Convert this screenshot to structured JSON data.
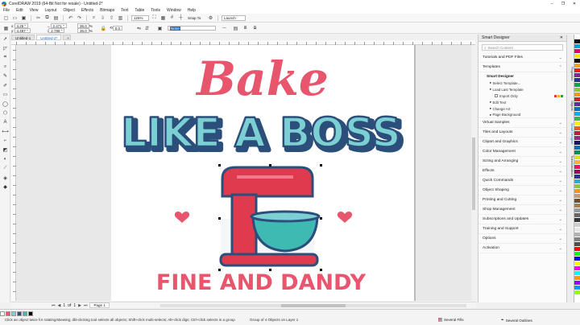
{
  "window": {
    "title": "CorelDRAW 2019 (64-Bit Not for resale) - Untitled-2*",
    "controls": [
      "–",
      "❐",
      "✕"
    ]
  },
  "menu": [
    "File",
    "Edit",
    "View",
    "Layout",
    "Object",
    "Effects",
    "Bitmaps",
    "Text",
    "Table",
    "Tools",
    "Window",
    "Help"
  ],
  "toolbar": {
    "zoom": "125%",
    "snap_to": "Snap To",
    "launch": "Launch"
  },
  "propbar": {
    "x": "4.25 \"",
    "y": "4.497 \"",
    "w": "2.471 \"",
    "h": "2.788 \"",
    "scale_w": "36.0",
    "scale_h": "36.0",
    "pct_w": "%",
    "pct_h": "%",
    "angle": "0.0",
    "outline": "None"
  },
  "tabs": [
    "Untitled-1",
    "Untitled-2*"
  ],
  "page_nav": {
    "current": "1",
    "of": "of",
    "total": "1",
    "page_label": "Page 1"
  },
  "status": {
    "message": "Click an object twice for rotating/skewing; dbl-clicking tool selects all objects; Shift+click multi-selects; Alt+click digs; Ctrl+click selects in a group",
    "selection": "Group of 4 Objects on Layer 1",
    "fill": "Several Fills",
    "outline": "Several Outlines"
  },
  "design": {
    "line1": "Bake",
    "line2": "LIKE A BOSS",
    "line3": "FINE AND DANDY"
  },
  "smart_designer": {
    "title": "Smart Designer",
    "search_placeholder": "Search Content",
    "sections": [
      "Tutorials and PDF Files",
      "Templates"
    ],
    "templates_header": "Smart Designer",
    "templates_items": [
      "Select Template...",
      "Load Last Template"
    ],
    "import_only": "Import Only",
    "edit_items": [
      "Edit Text",
      "Change Art",
      "Page Background"
    ],
    "more_sections": [
      "Virtual Samples",
      "Tiles and Layouts",
      "Clipart and Graphics",
      "Color Management",
      "Sizing and Arranging",
      "Effects",
      "Quick Commands",
      "Object Shaping",
      "Printing and Cutting",
      "Shop Management",
      "Subscriptions and Updates",
      "Training and Support",
      "Options",
      "Activation"
    ]
  },
  "docker_tabs": [
    "Properties",
    "Objects",
    "Smart Designer",
    "Transformations"
  ],
  "colors": {
    "pink": "#e8566e",
    "teal": "#7cd0d4",
    "navy": "#2b4f7a",
    "mixer_red": "#e03a4f",
    "bowl": "#3fbab2",
    "palette": [
      "#ffffff",
      "#000000",
      "#00a0e0",
      "#e0007a",
      "#ffe600",
      "#000000",
      "#f5a020",
      "#ed1c24",
      "#7b2c8d",
      "#2e3192",
      "#00a651",
      "#8dc63f",
      "#f7941d",
      "#c1272d",
      "#662d91",
      "#0072bc",
      "#00aeef",
      "#39b54a",
      "#fff200",
      "#f15a24",
      "#be1e2d",
      "#92278f",
      "#1b1464",
      "#0071bc",
      "#009245",
      "#d9e021",
      "#fbb03b",
      "#ed145b",
      "#9e005d",
      "#2e3192",
      "#29abe2",
      "#8cc63f",
      "#f7931e",
      "#c69c6d",
      "#754c24",
      "#a67c52",
      "#999999",
      "#666666",
      "#333333",
      "#cccccc",
      "#e6e6e6",
      "#b3b3b3",
      "#808080",
      "#4d4d4d",
      "#ff0000",
      "#00ff00",
      "#0000ff",
      "#ffff00",
      "#ff00ff",
      "#00ffff",
      "#ff9900",
      "#9900ff",
      "#0099ff",
      "#99ff00"
    ]
  }
}
